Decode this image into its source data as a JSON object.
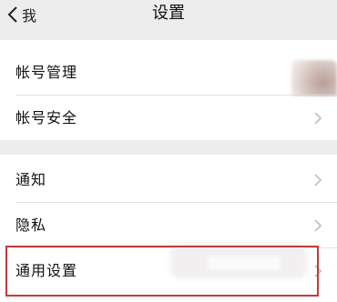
{
  "navbar": {
    "back_label": "我",
    "title": "设置"
  },
  "sections": [
    {
      "items": [
        {
          "label": "帐号管理",
          "has_avatar": true
        },
        {
          "label": "帐号安全",
          "has_arrow": true
        }
      ]
    },
    {
      "items": [
        {
          "label": "通知",
          "has_arrow": true
        },
        {
          "label": "隐私",
          "has_arrow": true
        },
        {
          "label": "通用设置",
          "has_arrow": true,
          "highlighted": true
        }
      ]
    }
  ],
  "colors": {
    "background": "#ededed",
    "row_background": "#ffffff",
    "highlight_border": "#c23b3b",
    "arrow": "#b8b8b8"
  },
  "icons": {
    "back": "chevron-left-icon",
    "row_arrow": "chevron-right-icon"
  }
}
